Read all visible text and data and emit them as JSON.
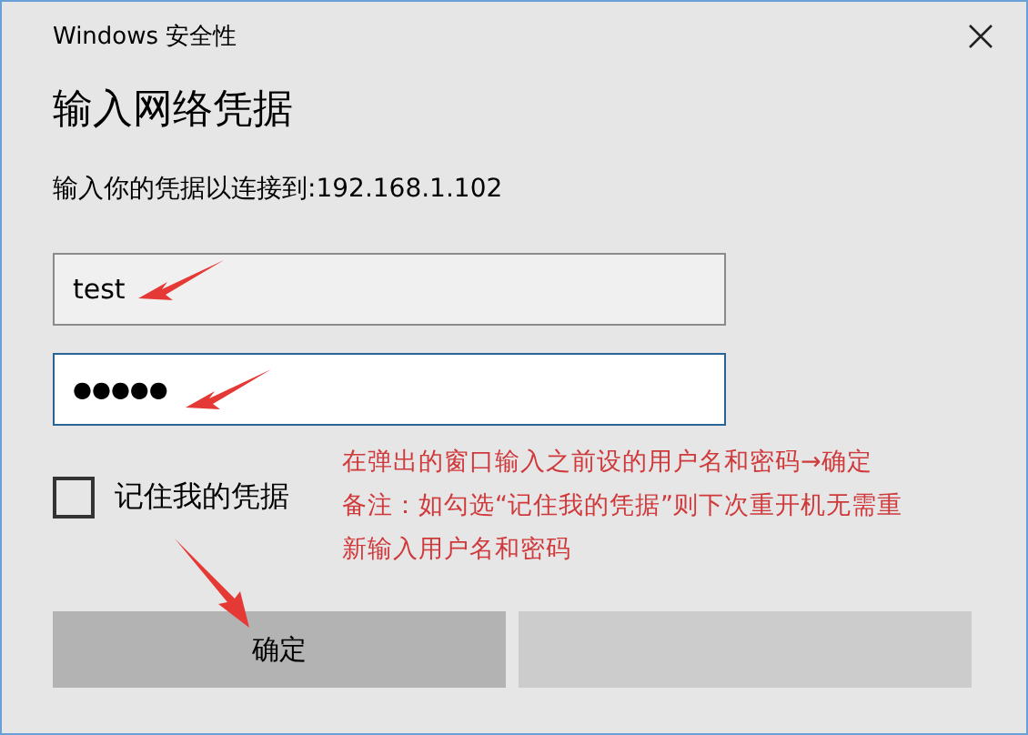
{
  "window": {
    "title": "Windows 安全性"
  },
  "heading": "输入网络凭据",
  "prompt": "输入你的凭据以连接到:192.168.1.102",
  "fields": [
    {
      "kind": "text",
      "value": "test",
      "focused": false
    },
    {
      "kind": "password",
      "value": "●●●●●",
      "focused": true
    }
  ],
  "remember": {
    "label": "记住我的凭据",
    "checked": false
  },
  "buttons": [
    {
      "kind": "primary",
      "label": "确定"
    },
    {
      "kind": "secondary"
    }
  ],
  "annotation": {
    "lines": [
      "在弹出的窗口输入之前设的用户名和密码→确定",
      "备注：如勾选“记住我的凭据”则下次重开机无需重",
      "新输入用户名和密码"
    ]
  }
}
